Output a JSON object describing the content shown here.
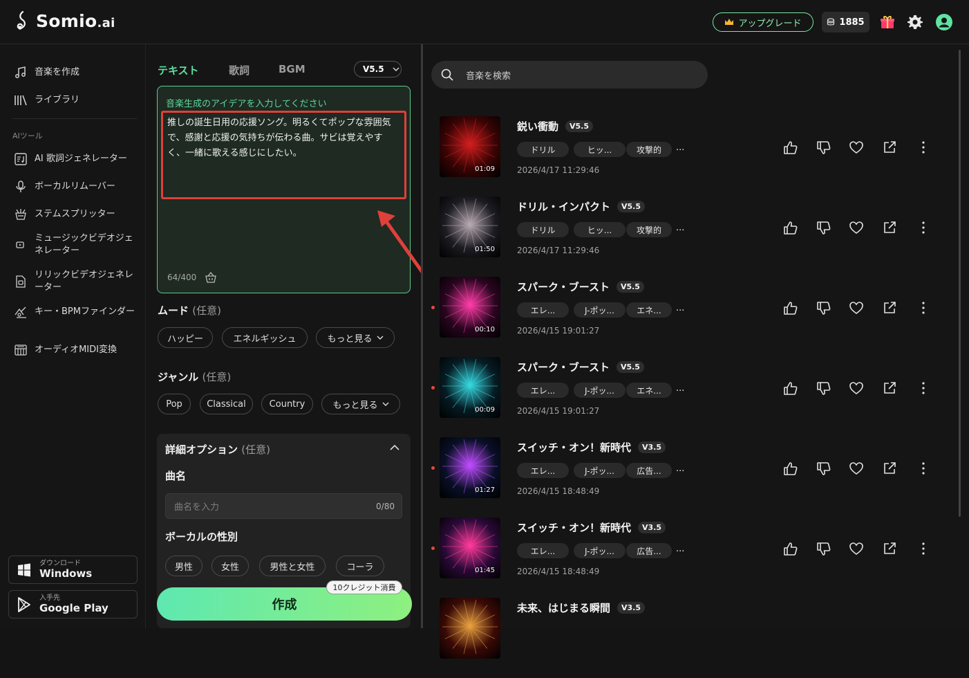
{
  "app": {
    "name": "Somio",
    "name_suffix": ".ai"
  },
  "topbar": {
    "upgrade_label": "アップグレード",
    "credits": "1885"
  },
  "sidebar": {
    "items": [
      {
        "label": "音楽を作成",
        "icon": "music-note-icon"
      },
      {
        "label": "ライブラリ",
        "icon": "library-icon"
      }
    ],
    "section_label": "AIツール",
    "tools": [
      {
        "label": "AI 歌詞ジェネレーター",
        "icon": "lyrics-icon"
      },
      {
        "label": "ボーカルリムーバー",
        "icon": "microphone-icon"
      },
      {
        "label": "ステムスプリッター",
        "icon": "stem-icon"
      },
      {
        "label": "ミュージックビデオジェネレーター",
        "icon": "video-icon"
      },
      {
        "label": "リリックビデオジェネレーター",
        "icon": "lyric-video-icon"
      },
      {
        "label": "キー・BPMファインダー",
        "icon": "key-bpm-icon"
      },
      {
        "label": "オーディオMIDI変換",
        "icon": "midi-icon"
      }
    ],
    "stores": [
      {
        "small": "ダウンロード",
        "big": "Windows"
      },
      {
        "small": "入手先",
        "big": "Google Play"
      }
    ]
  },
  "composer": {
    "tabs": [
      "テキスト",
      "歌詞",
      "BGM"
    ],
    "active_tab": 0,
    "version": "V5.5",
    "prompt_placeholder": "音楽生成のアイデアを入力してください",
    "prompt_text": "推しの誕生日用の応援ソング。明るくてポップな雰囲気で、感謝と応援の気持ちが伝わる曲。サビは覚えやすく、一緒に歌える感じにしたい。",
    "char_count": "64/400",
    "mood": {
      "title": "ムード",
      "optional": "(任意)",
      "chips": [
        "ハッピー",
        "エネルギッシュ"
      ],
      "more": "もっと見る"
    },
    "genre": {
      "title": "ジャンル",
      "optional": "(任意)",
      "chips": [
        "Pop",
        "Classical",
        "Country"
      ],
      "more": "もっと見る"
    },
    "details": {
      "title": "詳細オプション",
      "optional": "(任意)",
      "song_name_label": "曲名",
      "song_name_placeholder": "曲名を入力",
      "song_name_count": "0/80",
      "vocal_label": "ボーカルの性別",
      "vocal_options": [
        "男性",
        "女性",
        "男性と女性",
        "コーラ"
      ]
    },
    "credit_note": "10クレジット消費",
    "create_label": "作成"
  },
  "library": {
    "search_placeholder": "音楽を検索",
    "tracks": [
      {
        "title": "鋭い衝動",
        "version": "V5.5",
        "tags": [
          "ドリル",
          "ヒッ...",
          "攻撃的"
        ],
        "more": "...",
        "date": "2026/4/17 11:29:46",
        "duration": "01:09",
        "new": false,
        "colors": [
          "#3a0404",
          "#d21e1e"
        ]
      },
      {
        "title": "ドリル・インパクト",
        "version": "V5.5",
        "tags": [
          "ドリル",
          "ヒッ...",
          "攻撃的"
        ],
        "more": "...",
        "date": "2026/4/17 11:29:46",
        "duration": "01:50",
        "new": false,
        "colors": [
          "#1c1c22",
          "#b8a8b0"
        ]
      },
      {
        "title": "スパーク・ブースト",
        "version": "V5.5",
        "tags": [
          "エレ...",
          "J-ポッ...",
          "エネ..."
        ],
        "more": "...",
        "date": "2026/4/15 19:01:27",
        "duration": "00:10",
        "new": true,
        "colors": [
          "#2a0620",
          "#ff3ca8"
        ]
      },
      {
        "title": "スパーク・ブースト",
        "version": "V5.5",
        "tags": [
          "エレ...",
          "J-ポッ...",
          "エネ..."
        ],
        "more": "...",
        "date": "2026/4/15 19:01:27",
        "duration": "00:09",
        "new": true,
        "colors": [
          "#061c24",
          "#36d8e0"
        ]
      },
      {
        "title": "スイッチ・オン！新時代",
        "version": "V3.5",
        "tags": [
          "エレ...",
          "J-ポッ...",
          "広告..."
        ],
        "more": "...",
        "date": "2026/4/15 18:48:49",
        "duration": "01:27",
        "new": true,
        "colors": [
          "#0a1028",
          "#c04cff"
        ]
      },
      {
        "title": "スイッチ・オン！新時代",
        "version": "V3.5",
        "tags": [
          "エレ...",
          "J-ポッ...",
          "広告..."
        ],
        "more": "...",
        "date": "2026/4/15 18:48:49",
        "duration": "01:45",
        "new": true,
        "colors": [
          "#2a0a38",
          "#ff3a9a"
        ]
      },
      {
        "title": "未来、はじまる瞬間",
        "version": "V3.5",
        "tags": [],
        "more": "",
        "date": "",
        "duration": "",
        "new": false,
        "colors": [
          "#3a0a06",
          "#e8a040"
        ]
      }
    ]
  }
}
